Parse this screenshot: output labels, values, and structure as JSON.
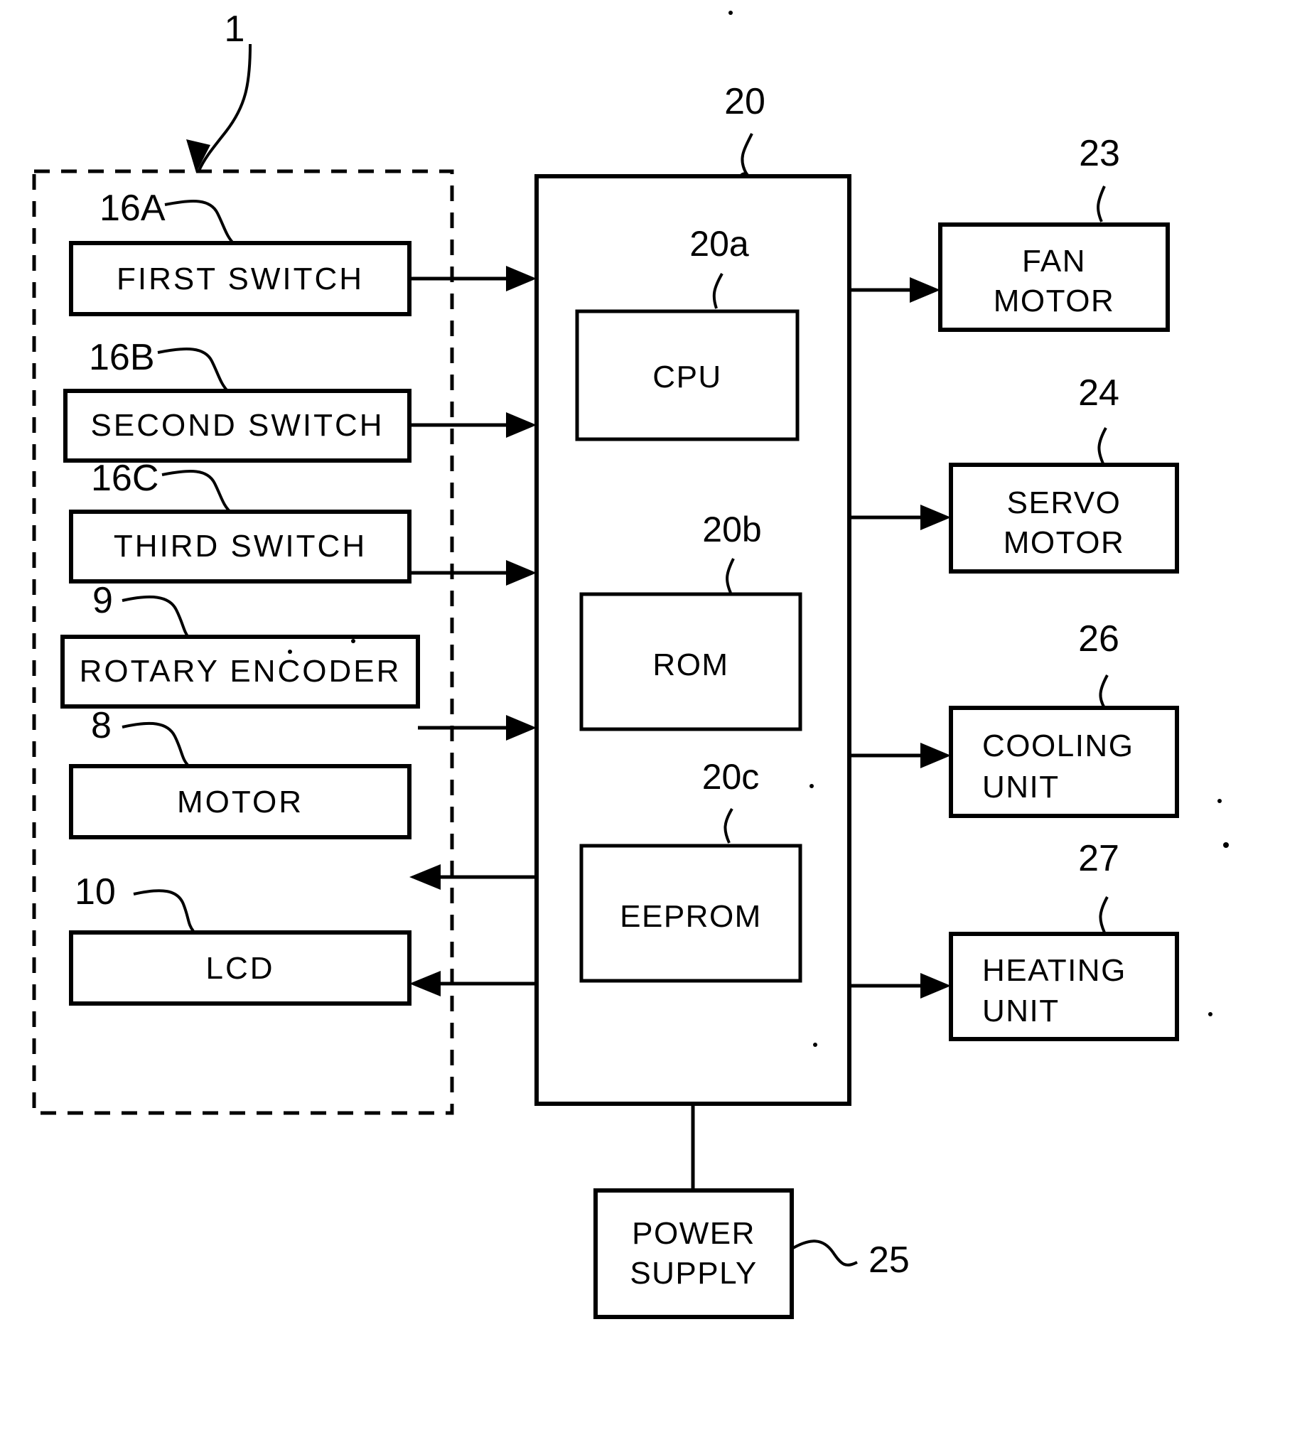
{
  "figure": {
    "type": "patent-block-diagram",
    "background": "#ffffff",
    "line_color": "#000000"
  },
  "reference_numerals": {
    "system": "1",
    "first_switch": "16A",
    "second_switch": "16B",
    "third_switch": "16C",
    "rotary_encoder": "9",
    "motor": "8",
    "lcd": "10",
    "control_unit": "20",
    "cpu": "20a",
    "rom": "20b",
    "eeprom": "20c",
    "fan_motor": "23",
    "servo_motor": "24",
    "power_supply": "25",
    "cooling_unit": "26",
    "heating_unit": "27"
  },
  "left_group": {
    "enclosure_label": "1",
    "blocks": [
      {
        "ref": "16A",
        "label": "FIRST  SWITCH",
        "direction": "to-controller"
      },
      {
        "ref": "16B",
        "label": "SECOND  SWITCH",
        "direction": "to-controller"
      },
      {
        "ref": "16C",
        "label": "THIRD  SWITCH",
        "direction": "to-controller"
      },
      {
        "ref": "9",
        "label": "ROTARY  ENCODER",
        "direction": "to-controller"
      },
      {
        "ref": "8",
        "label": "MOTOR",
        "direction": "from-controller"
      },
      {
        "ref": "10",
        "label": "LCD",
        "direction": "from-controller"
      }
    ]
  },
  "controller": {
    "ref": "20",
    "inner_blocks": [
      {
        "ref": "20a",
        "label": "CPU"
      },
      {
        "ref": "20b",
        "label": "ROM"
      },
      {
        "ref": "20c",
        "label": "EEPROM"
      }
    ]
  },
  "right_group": {
    "blocks": [
      {
        "ref": "23",
        "lines": [
          "FAN",
          "MOTOR"
        ],
        "align": "center"
      },
      {
        "ref": "24",
        "lines": [
          "SERVO",
          "MOTOR"
        ],
        "align": "center"
      },
      {
        "ref": "26",
        "lines": [
          "COOLING",
          "UNIT"
        ],
        "align": "left"
      },
      {
        "ref": "27",
        "lines": [
          "HEATING",
          "UNIT"
        ],
        "align": "left"
      }
    ]
  },
  "bottom_block": {
    "ref": "25",
    "lines": [
      "POWER",
      "SUPPLY"
    ]
  }
}
